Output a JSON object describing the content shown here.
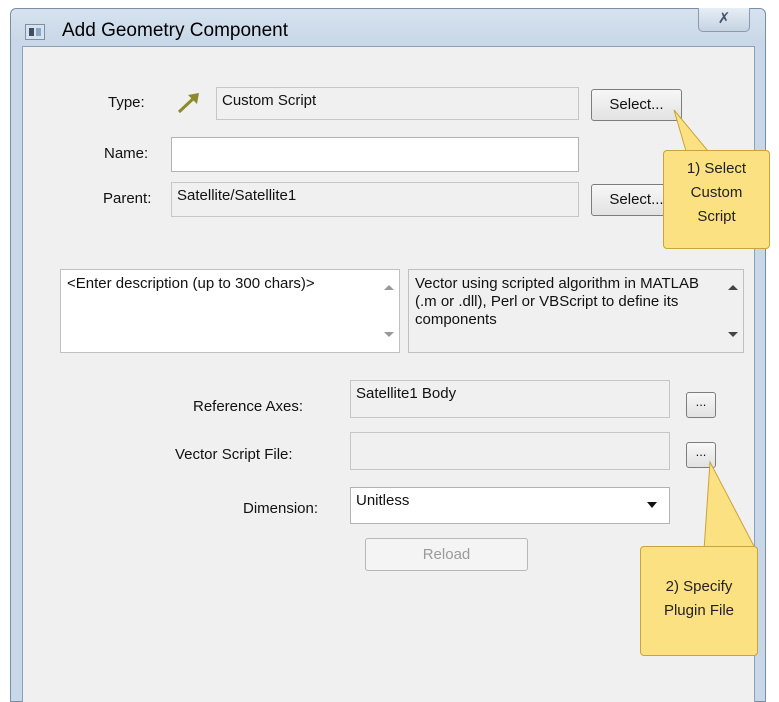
{
  "window": {
    "title": "Add Geometry Component",
    "close_glyph": "✗"
  },
  "form": {
    "type_label": "Type:",
    "type_value": "Custom Script",
    "type_icon": "vector-arrow-icon",
    "type_select_button": "Select...",
    "name_label": "Name:",
    "name_value": "",
    "parent_label": "Parent:",
    "parent_value": "Satellite/Satellite1",
    "parent_select_button": "Select..."
  },
  "description": {
    "user_text": "<Enter description (up to 300 chars)>",
    "type_description": "Vector using scripted algorithm in MATLAB (.m or .dll), Perl or VBScript to define its components"
  },
  "settings": {
    "reference_axes_label": "Reference Axes:",
    "reference_axes_value": "Satellite1 Body",
    "reference_axes_button": "...",
    "script_file_label": "Vector Script File:",
    "script_file_value": "",
    "script_file_button": "...",
    "dimension_label": "Dimension:",
    "dimension_value": "Unitless",
    "reload_button": "Reload"
  },
  "callouts": {
    "select_custom_script": [
      "1) Select",
      "Custom",
      "Script"
    ],
    "specify_plugin": [
      "2) Specify",
      "Plugin File"
    ]
  },
  "colors": {
    "callout": "#fce183",
    "callout_border": "#c9a43a",
    "arrow_icon": "#8c8a2a"
  }
}
